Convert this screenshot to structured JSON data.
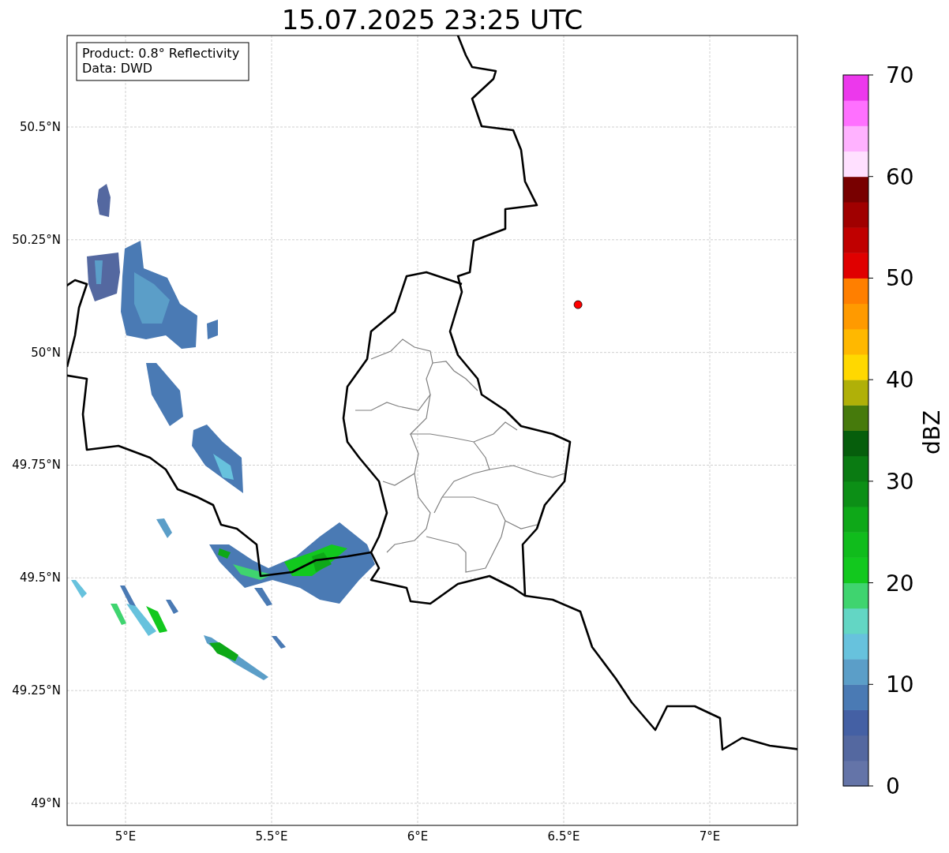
{
  "title": "15.07.2025 23:25 UTC",
  "info_box": [
    "Product: 0.8° Reflectivity",
    "Data: DWD"
  ],
  "map": {
    "xticks": [
      "5°E",
      "5.5°E",
      "6°E",
      "6.5°E",
      "7°E"
    ],
    "yticks": [
      "50.5°N",
      "50.25°N",
      "50°N",
      "49.75°N",
      "49.5°N",
      "49.25°N",
      "49°N"
    ],
    "marker": {
      "color": "#ff0000"
    }
  },
  "colorbar": {
    "label": "dBZ",
    "ticks": [
      "70",
      "60",
      "50",
      "40",
      "30",
      "20",
      "10",
      "0"
    ],
    "bands": [
      {
        "color": "#6474a8"
      },
      {
        "color": "#5468a0"
      },
      {
        "color": "#4460a4"
      },
      {
        "color": "#4a7ab4"
      },
      {
        "color": "#5b9ec8"
      },
      {
        "color": "#67c2dd"
      },
      {
        "color": "#63d6c4"
      },
      {
        "color": "#3fd46f"
      },
      {
        "color": "#12c81e"
      },
      {
        "color": "#10bc1c"
      },
      {
        "color": "#0ea818"
      },
      {
        "color": "#0c8f16"
      },
      {
        "color": "#0a7b12"
      },
      {
        "color": "#065e0c"
      },
      {
        "color": "#467a0c"
      },
      {
        "color": "#b0b008"
      },
      {
        "color": "#ffd800"
      },
      {
        "color": "#ffb800"
      },
      {
        "color": "#ff9a00"
      },
      {
        "color": "#ff7f00"
      },
      {
        "color": "#e00000"
      },
      {
        "color": "#c00000"
      },
      {
        "color": "#a00000"
      },
      {
        "color": "#780000"
      },
      {
        "color": "#ffe0ff"
      },
      {
        "color": "#ffb2ff"
      },
      {
        "color": "#ff70ff"
      },
      {
        "color": "#ec38ec"
      }
    ]
  }
}
